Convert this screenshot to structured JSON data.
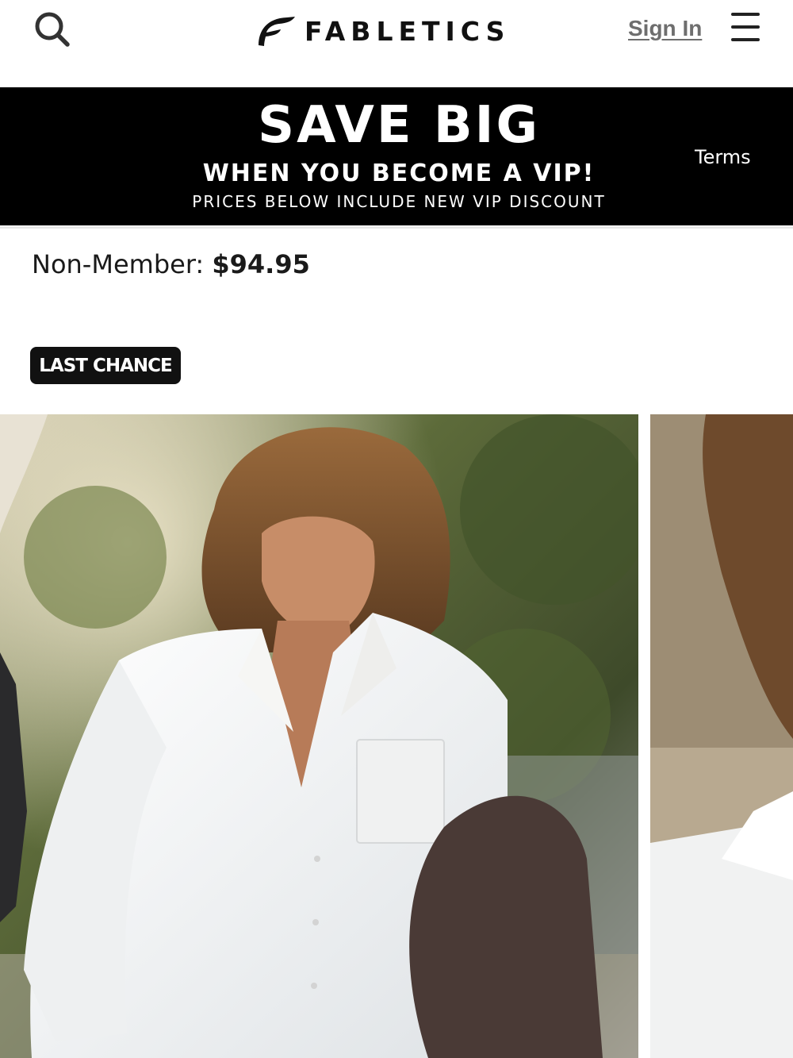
{
  "header": {
    "brand": "FABLETICS",
    "sign_in_label": "Sign In",
    "icons": {
      "search": "search-icon",
      "menu": "hamburger-menu-icon",
      "logo": "fabletics-logo-mark"
    }
  },
  "promo": {
    "headline": "SAVE BIG",
    "subheadline": "WHEN YOU BECOME A VIP!",
    "note": "PRICES BELOW INCLUDE NEW VIP DISCOUNT",
    "terms_label": "Terms"
  },
  "product": {
    "price_label": "Non-Member:",
    "price": "$94.95",
    "badge": "LAST CHANCE"
  },
  "carousel": {
    "images": [
      {
        "name": "product-image-model-white-shirt"
      },
      {
        "name": "product-image-model-collar-detail"
      }
    ]
  },
  "colors": {
    "banner_bg": "#000000",
    "badge_bg": "#111111",
    "sign_in": "#6e6e6e",
    "text": "#111111"
  }
}
